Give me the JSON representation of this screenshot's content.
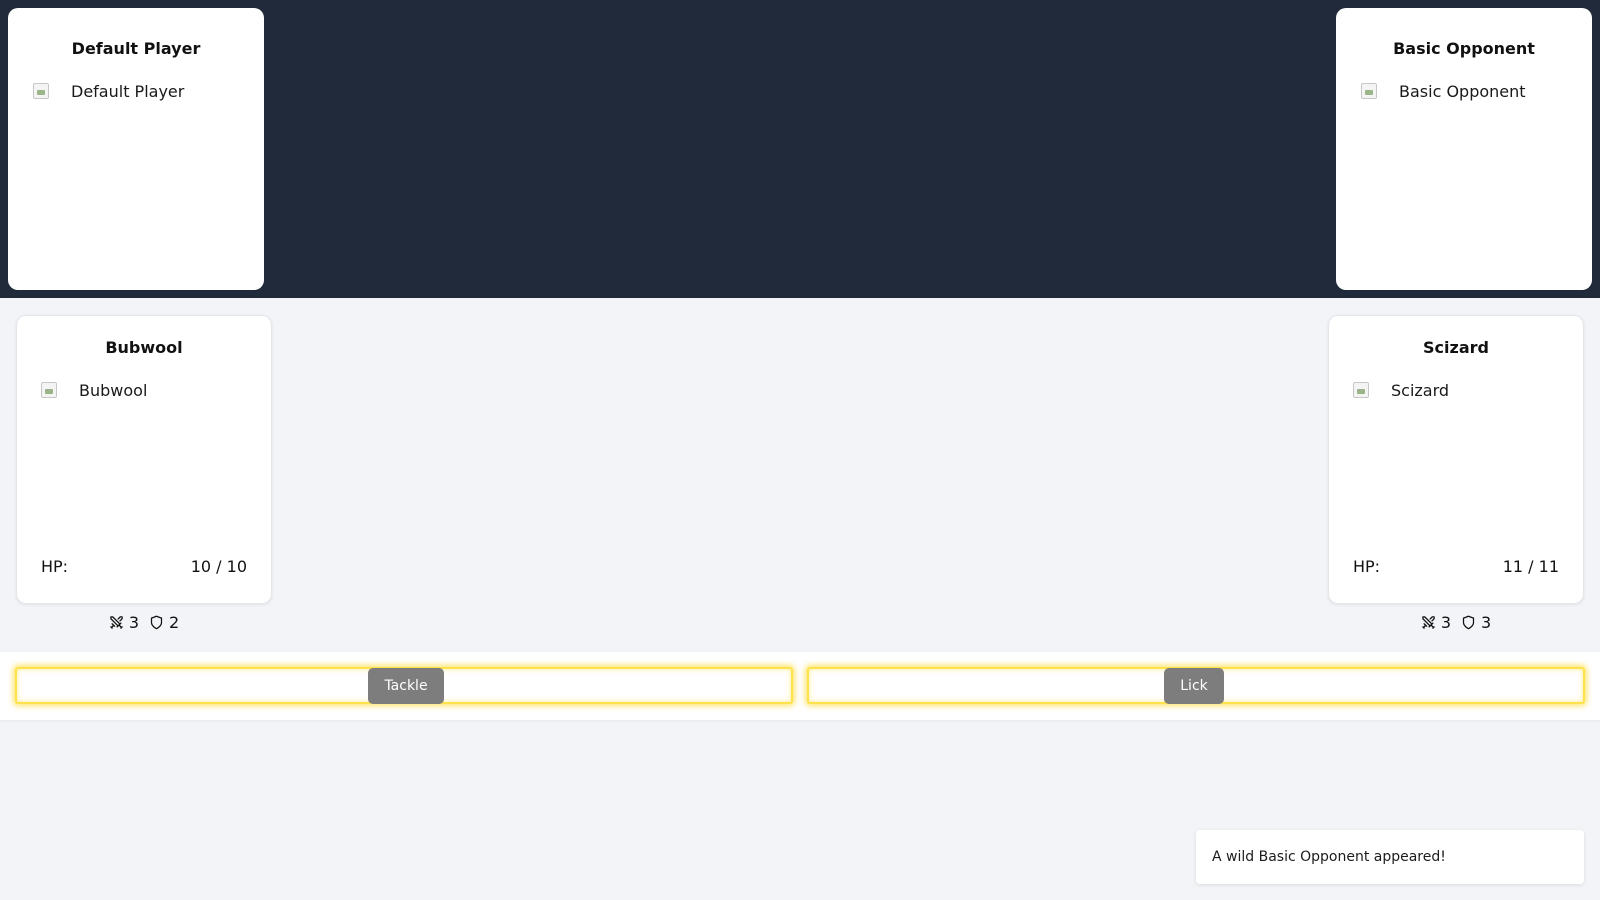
{
  "player": {
    "name": "Default Player",
    "image_alt": "Default Player"
  },
  "opponent": {
    "name": "Basic Opponent",
    "image_alt": "Basic Opponent"
  },
  "player_monster": {
    "name": "Bubwool",
    "image_alt": "Bubwool",
    "hp_label": "HP:",
    "hp_value": "10 / 10",
    "attack": "3",
    "defense": "2"
  },
  "opponent_monster": {
    "name": "Scizard",
    "image_alt": "Scizard",
    "hp_label": "HP:",
    "hp_value": "11 / 11",
    "attack": "3",
    "defense": "3"
  },
  "moves": [
    {
      "label": "Tackle"
    },
    {
      "label": "Lick"
    }
  ],
  "icons": {
    "attack": "crossed-swords-icon",
    "defense": "shield-icon",
    "image": "broken-image-icon"
  },
  "colors": {
    "header_bg": "#212a3b",
    "page_bg": "#f2f4f7",
    "move_highlight": "#ffe14d",
    "move_button": "#7d7d7d"
  },
  "log": {
    "message": "A wild Basic Opponent appeared!"
  }
}
